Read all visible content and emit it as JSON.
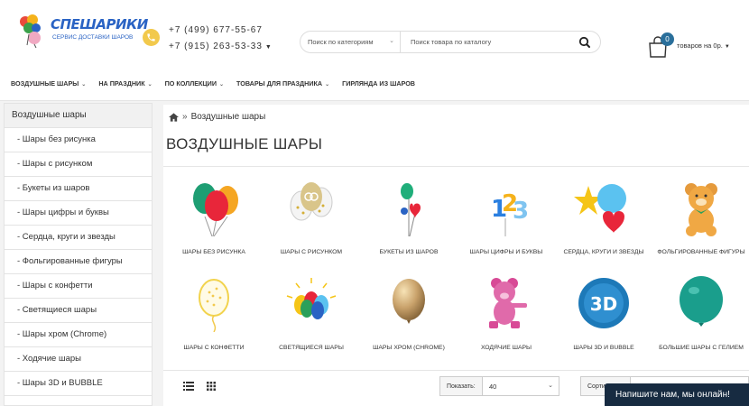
{
  "header": {
    "logo_title": "СПЕШАРИКИ",
    "logo_subtitle": "СЕРВИС ДОСТАВКИ ШАРОВ",
    "phone1": "+7 (499) 677-55-67",
    "phone2": "+7 (915) 263-53-33",
    "search": {
      "category_placeholder": "Поиск по категориям",
      "input_placeholder": "Поиск товара по каталогу"
    },
    "cart": {
      "count": "0",
      "label": "товаров на 0р."
    }
  },
  "nav": {
    "items": [
      {
        "label": "ВОЗДУШНЫЕ ШАРЫ",
        "has_dropdown": true
      },
      {
        "label": "НА ПРАЗДНИК",
        "has_dropdown": true
      },
      {
        "label": "ПО КОЛЛЕКЦИИ",
        "has_dropdown": true
      },
      {
        "label": "ТОВАРЫ ДЛЯ ПРАЗДНИКА",
        "has_dropdown": true
      },
      {
        "label": "ГИРЛЯНДА ИЗ ШАРОВ",
        "has_dropdown": false
      }
    ]
  },
  "sidebar": {
    "heading": "Воздушные шары",
    "items": [
      {
        "label": "- Шары без рисунка"
      },
      {
        "label": "- Шары с рисунком"
      },
      {
        "label": "- Букеты из шаров"
      },
      {
        "label": "- Шары цифры и буквы"
      },
      {
        "label": "- Сердца, круги и звезды"
      },
      {
        "label": "- Фольгированные фигуры"
      },
      {
        "label": "- Шары с конфетти"
      },
      {
        "label": "- Светящиеся шары"
      },
      {
        "label": "- Шары хром (Chrome)"
      },
      {
        "label": "- Ходячие шары"
      },
      {
        "label": "- Шары 3D и BUBBLE"
      }
    ]
  },
  "main": {
    "breadcrumb": {
      "separator": "»",
      "current": "Воздушные шары"
    },
    "title": "ВОЗДУШНЫЕ ШАРЫ",
    "categories": [
      {
        "label": "ШАРЫ БЕЗ РИСУНКА",
        "icon": "plain-balloons-icon"
      },
      {
        "label": "ШАРЫ С РИСУНКОМ",
        "icon": "printed-balloons-icon"
      },
      {
        "label": "БУКЕТЫ ИЗ ШАРОВ",
        "icon": "balloon-bouquet-icon"
      },
      {
        "label": "ШАРЫ ЦИФРЫ И БУКВЫ",
        "icon": "number-balloons-icon"
      },
      {
        "label": "СЕРДЦА, КРУГИ И ЗВЕЗДЫ",
        "icon": "heart-star-balloons-icon"
      },
      {
        "label": "ФОЛЬГИРОВАННЫЕ ФИГУРЫ",
        "icon": "teddy-bear-balloon-icon"
      },
      {
        "label": "ШАРЫ С КОНФЕТТИ",
        "icon": "confetti-balloon-icon"
      },
      {
        "label": "СВЕТЯЩИЕСЯ ШАРЫ",
        "icon": "glowing-balloons-icon"
      },
      {
        "label": "ШАРЫ ХРОМ (CHROME)",
        "icon": "chrome-balloon-icon"
      },
      {
        "label": "ХОДЯЧИЕ ШАРЫ",
        "icon": "walking-bear-balloon-icon"
      },
      {
        "label": "ШАРЫ 3D И BUBBLE",
        "icon": "3d-balloon-icon"
      },
      {
        "label": "БОЛЬШИЕ ШАРЫ С ГЕЛИЕМ",
        "icon": "large-helium-balloon-icon"
      }
    ],
    "toolbar": {
      "show_label": "Показать:",
      "show_value": "40",
      "sort_label": "Сортировка:"
    }
  },
  "chat": {
    "label": "Напишите нам, мы онлайн!"
  },
  "colors": {
    "brand_blue": "#2a63c4",
    "phone_yellow": "#f2c94c",
    "badge": "#2a6f9b",
    "chat_bg": "#172b41"
  }
}
